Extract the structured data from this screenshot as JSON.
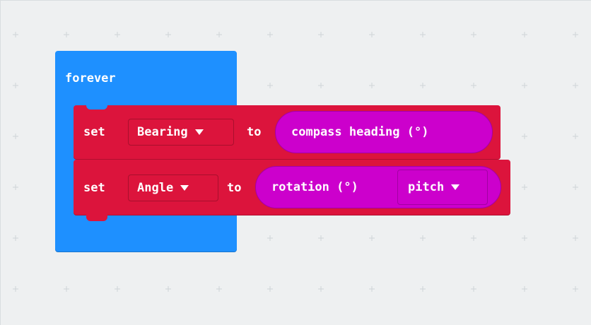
{
  "workspace": {
    "background": "#eef0f1"
  },
  "colors": {
    "loop_block": "#1e90ff",
    "variable_block": "#dc143c",
    "input_block": "#cc00cc"
  },
  "forever_block": {
    "label": "forever"
  },
  "statements": [
    {
      "keyword": "set",
      "variable": "Bearing",
      "to_label": "to",
      "reporter": {
        "label": "compass heading (°)"
      }
    },
    {
      "keyword": "set",
      "variable": "Angle",
      "to_label": "to",
      "reporter": {
        "label": "rotation (°)",
        "option": "pitch"
      }
    }
  ],
  "icons": {
    "dropdown": "chevron-down-icon"
  }
}
